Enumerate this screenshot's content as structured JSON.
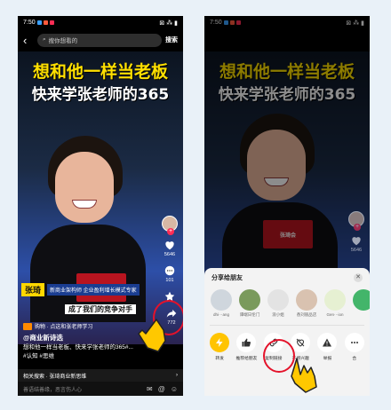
{
  "status": {
    "time": "7:50"
  },
  "search": {
    "placeholder": "搜你想看的",
    "button": "搜索",
    "back": "‹"
  },
  "video": {
    "title_line1": "想和他一样当老板",
    "title_line2": "快来学张老师的365",
    "name_tag": "张琦",
    "role_tag": "新商业架构师  企业盈利增长模式专家",
    "subtitle": "成了我们的竞争对手",
    "board_logo": "张琦会"
  },
  "sidebar": {
    "likes": "5646",
    "comments": "101",
    "shares": "772"
  },
  "info": {
    "shop_text": "购物 · 点这和张老师学习",
    "author": "@商业新诗选",
    "description": "想和他一样当老板、快来学张老师的365#...",
    "tags": "#认知 #思维"
  },
  "related": {
    "text": "相关搜索 · 张琦商业新思维",
    "arrow": "›"
  },
  "comment_bar": {
    "placeholder": "善语结善缘，恶言伤人心",
    "icons": [
      "✉",
      "@",
      "☺"
    ]
  },
  "share_sheet": {
    "title": "分享给朋友",
    "close": "✕",
    "friends": [
      {
        "name": "dhi···ang",
        "color": "#cfd6dd"
      },
      {
        "name": "谭端日伦门",
        "color": "#7a9a5c"
      },
      {
        "name": "浪小姐",
        "color": "#e3e3e3"
      },
      {
        "name": "香刘丽品店",
        "color": "#d9c2b0"
      },
      {
        "name": "Gen···ion",
        "color": "#e6f0d2"
      },
      {
        "name": "",
        "color": "#43b56a"
      }
    ],
    "actions": [
      {
        "label": "转发",
        "icon": "lightning-icon",
        "bg": "#ffc400"
      },
      {
        "label": "推荐给朋友",
        "icon": "thumbs-up-icon",
        "bg": "#ffffff"
      },
      {
        "label": "复制链接",
        "icon": "link-icon",
        "bg": "#ffffff"
      },
      {
        "label": "不感兴趣",
        "icon": "dislike-icon",
        "bg": "#ffffff"
      },
      {
        "label": "举报",
        "icon": "warning-icon",
        "bg": "#ffffff"
      },
      {
        "label": "合",
        "icon": "more-icon",
        "bg": "#ffffff"
      }
    ]
  }
}
